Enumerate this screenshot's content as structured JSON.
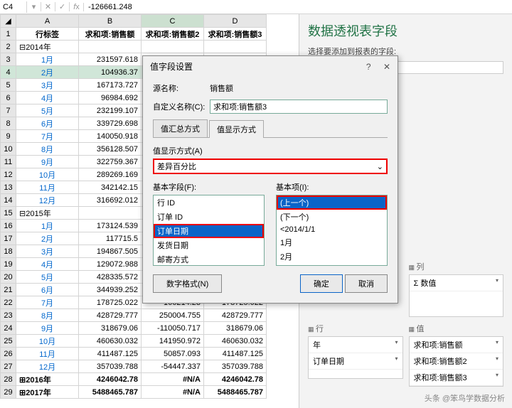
{
  "formula": {
    "cell": "C4",
    "value": "-126661.248"
  },
  "columns": [
    "",
    "A",
    "B",
    "C",
    "D"
  ],
  "headers": {
    "rowlabel": "行标签",
    "b": "求和项:销售额",
    "c": "求和项:销售额2",
    "d": "求和项:销售额3"
  },
  "rows": [
    {
      "n": "1",
      "lbl": "行标签",
      "b": "求和项:销售额",
      "c": "求和项:销售额2",
      "d": "求和项:销售额3",
      "hdr": true
    },
    {
      "n": "2",
      "lbl": "⊟2014年",
      "year": true
    },
    {
      "n": "3",
      "lbl": "1月",
      "b": "231597.618"
    },
    {
      "n": "4",
      "lbl": "2月",
      "b": "104936.37",
      "sel": true
    },
    {
      "n": "5",
      "lbl": "3月",
      "b": "167173.727"
    },
    {
      "n": "6",
      "lbl": "4月",
      "b": "96984.692"
    },
    {
      "n": "7",
      "lbl": "5月",
      "b": "232199.107"
    },
    {
      "n": "8",
      "lbl": "6月",
      "b": "339729.698"
    },
    {
      "n": "9",
      "lbl": "7月",
      "b": "140050.918"
    },
    {
      "n": "10",
      "lbl": "8月",
      "b": "356128.507"
    },
    {
      "n": "11",
      "lbl": "9月",
      "b": "322759.367"
    },
    {
      "n": "12",
      "lbl": "10月",
      "b": "289269.169"
    },
    {
      "n": "13",
      "lbl": "11月",
      "b": "342142.15"
    },
    {
      "n": "14",
      "lbl": "12月",
      "b": "316692.012"
    },
    {
      "n": "15",
      "lbl": "⊟2015年",
      "year": true
    },
    {
      "n": "16",
      "lbl": "1月",
      "b": "173124.539"
    },
    {
      "n": "17",
      "lbl": "2月",
      "b": "117715.5"
    },
    {
      "n": "18",
      "lbl": "3月",
      "b": "194867.505"
    },
    {
      "n": "19",
      "lbl": "4月",
      "b": "129072.988"
    },
    {
      "n": "20",
      "lbl": "5月",
      "b": "428335.572"
    },
    {
      "n": "21",
      "lbl": "6月",
      "b": "344939.252",
      "c": "-83396.495",
      "d": "344939.252"
    },
    {
      "n": "22",
      "lbl": "7月",
      "b": "178725.022",
      "c": "-166214.23",
      "d": "178725.022"
    },
    {
      "n": "23",
      "lbl": "8月",
      "b": "428729.777",
      "c": "250004.755",
      "d": "428729.777"
    },
    {
      "n": "24",
      "lbl": "9月",
      "b": "318679.06",
      "c": "-110050.717",
      "d": "318679.06"
    },
    {
      "n": "25",
      "lbl": "10月",
      "b": "460630.032",
      "c": "141950.972",
      "d": "460630.032"
    },
    {
      "n": "26",
      "lbl": "11月",
      "b": "411487.125",
      "c": "50857.093",
      "d": "411487.125"
    },
    {
      "n": "27",
      "lbl": "12月",
      "b": "357039.788",
      "c": "-54447.337",
      "d": "357039.788"
    },
    {
      "n": "28",
      "lbl": "⊞2016年",
      "b": "4246042.78",
      "c": "#N/A",
      "d": "4246042.78",
      "bold": true,
      "year": true
    },
    {
      "n": "29",
      "lbl": "⊞2017年",
      "b": "5488465.787",
      "c": "#N/A",
      "d": "5488465.787",
      "bold": true,
      "year": true
    }
  ],
  "pane": {
    "title": "数据透视表字段",
    "sub": "选择要添加到报表的字段:",
    "areas": {
      "cols_lbl": "列",
      "cols": [
        "Σ 数值"
      ],
      "rows_lbl": "行",
      "rows": [
        "年",
        "订单日期"
      ],
      "vals_lbl": "值",
      "vals": [
        "求和项:销售额",
        "求和项:销售额2",
        "求和项:销售额3"
      ]
    }
  },
  "dialog": {
    "title": "值字段设置",
    "source_lbl": "源名称:",
    "source": "销售额",
    "custom_lbl": "自定义名称(C):",
    "custom": "求和项:销售额3",
    "tab1": "值汇总方式",
    "tab2": "值显示方式",
    "show_as_lbl": "值显示方式(A)",
    "show_as": "差异百分比",
    "base_field_lbl": "基本字段(F):",
    "base_fields": [
      "行 ID",
      "订单 ID",
      "订单日期",
      "发货日期",
      "邮寄方式",
      "客户 ID"
    ],
    "base_field_sel": "订单日期",
    "base_item_lbl": "基本项(I):",
    "base_items": [
      "(上一个)",
      "(下一个)",
      "<2014/1/1",
      "1月",
      "2月",
      "3月"
    ],
    "base_item_sel": "(上一个)",
    "numfmt": "数字格式(N)",
    "ok": "确定",
    "cancel": "取消"
  },
  "watermark": "@笨鸟学数据分析"
}
